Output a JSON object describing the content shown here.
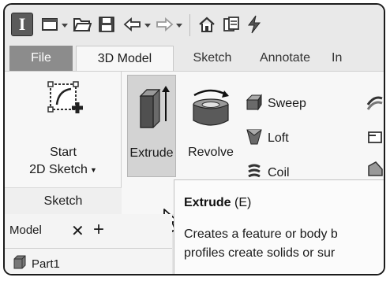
{
  "app": {
    "logo_letter": "I"
  },
  "quick_access": {
    "icons": [
      "new-file-icon",
      "open-folder-icon",
      "save-icon",
      "undo-icon",
      "redo-icon",
      "home-icon",
      "project-icon",
      "update-icon"
    ]
  },
  "ribbon_tabs": [
    {
      "label": "File"
    },
    {
      "label": "3D Model",
      "active": true
    },
    {
      "label": "Sketch"
    },
    {
      "label": "Annotate"
    },
    {
      "label": "In"
    }
  ],
  "ribbon": {
    "sketch_panel": {
      "start_button": {
        "line1": "Start",
        "line2": "2D Sketch"
      },
      "label": "Sketch"
    },
    "extrude_button": {
      "label": "Extrude"
    },
    "revolve_button": {
      "label": "Revolve"
    },
    "small_buttons": [
      {
        "label": "Sweep",
        "icon": "sweep-icon"
      },
      {
        "label": "Loft",
        "icon": "loft-icon"
      },
      {
        "label": "Coil",
        "icon": "coil-icon"
      }
    ]
  },
  "browser": {
    "tab_label": "Model",
    "close_glyph": "✕",
    "add_glyph": "+",
    "items": [
      {
        "label": "Part1",
        "icon": "part-icon"
      }
    ]
  },
  "tooltip": {
    "title": "Extrude",
    "shortcut": "(E)",
    "line1": "Creates a feature or body b",
    "line2": "profiles create solids or sur"
  },
  "colors": {
    "file_tab": "#8c8c8c",
    "active_tab": "#f7f7f7",
    "pressed_button": "#d3d3d3"
  }
}
